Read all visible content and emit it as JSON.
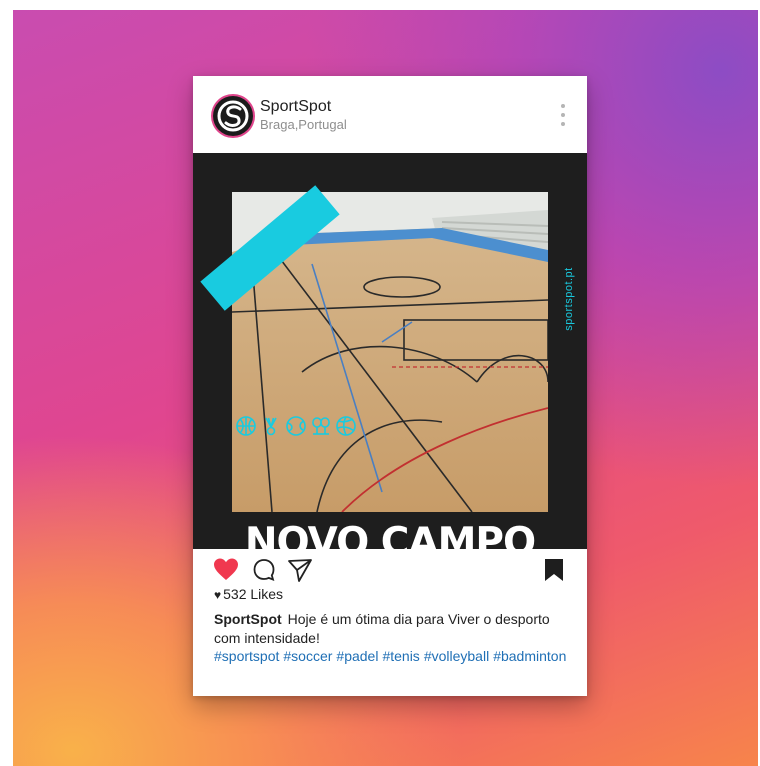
{
  "account": {
    "username": "SportSpot",
    "location": "Braga,Portugal"
  },
  "post": {
    "site_label": "sportspot.pt",
    "headline": "NOVO CAMPO",
    "sport_icons": [
      "basketball-icon",
      "badminton-icon",
      "tennis-ball-icon",
      "padel-icon",
      "volleyball-icon"
    ]
  },
  "engagement": {
    "likes_text": "532 Likes",
    "liked": true
  },
  "caption": {
    "author": "SportSpot",
    "text": "Hoje é um ótima dia para Viver o desporto com intensidade!",
    "hashtags": [
      "#sportspot",
      "#soccer",
      "#padel",
      "#tenis",
      "#volleyball",
      "#badminton"
    ]
  },
  "colors": {
    "accent_cyan": "#19cbe0",
    "like_red": "#f0384f",
    "hashtag_blue": "#1f6fb5",
    "post_bg": "#1e1e1e"
  }
}
